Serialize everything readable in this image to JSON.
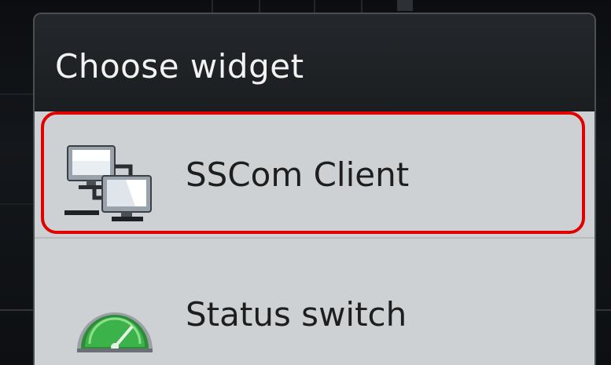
{
  "dialog": {
    "title": "Choose widget",
    "items": [
      {
        "label": "SSCom Client",
        "icon": "network-computers-icon",
        "highlighted": true
      },
      {
        "label": "Status switch",
        "icon": "speedometer-gauge-icon",
        "highlighted": false
      }
    ]
  },
  "colors": {
    "header_bg": "#1d2023",
    "list_bg": "#cdd1d4",
    "highlight_border": "#e00000",
    "gauge_green": "#3cb34a"
  }
}
